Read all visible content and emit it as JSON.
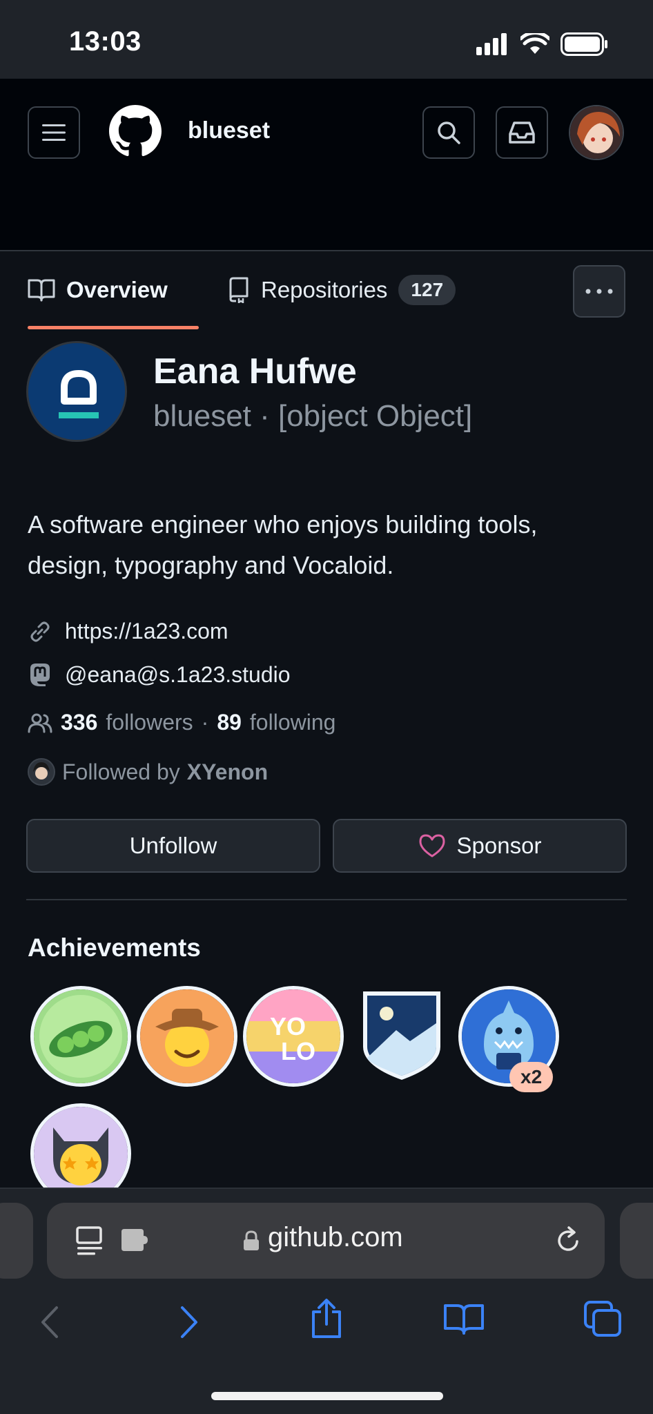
{
  "status_bar": {
    "time": "13:03"
  },
  "header": {
    "username": "blueset",
    "tabs": [
      {
        "label": "Overview",
        "active": true
      },
      {
        "label": "Repositories",
        "count": "127"
      }
    ]
  },
  "profile": {
    "name": "Eana Hufwe",
    "login_line": "blueset · [object Object]",
    "bio": "A software engineer who enjoys building tools, design, typography and Vocaloid.",
    "website": "https://1a23.com",
    "mastodon": "@eana@s.1a23.studio",
    "followers_count": "336",
    "followers_label": "followers",
    "separator": "·",
    "following_count": "89",
    "following_label": "following",
    "followed_by_label": "Followed by",
    "followed_by_user": "XYenon"
  },
  "actions": {
    "unfollow_label": "Unfollow",
    "sponsor_label": "Sponsor"
  },
  "achievements": {
    "title": "Achievements",
    "badges": [
      {
        "name": "pea-pod-badge"
      },
      {
        "name": "cowboy-badge"
      },
      {
        "name": "yolo-badge"
      },
      {
        "name": "arctic-badge"
      },
      {
        "name": "shark-badge",
        "multiplier": "x2"
      },
      {
        "name": "starstruck-badge"
      }
    ]
  },
  "browser": {
    "url": "github.com"
  },
  "colors": {
    "accent_underline": "#f78166",
    "sponsor_heart": "#db61a2",
    "badge_multiplier": "#ffc6b2",
    "safari_blue": "#3b82f6"
  }
}
